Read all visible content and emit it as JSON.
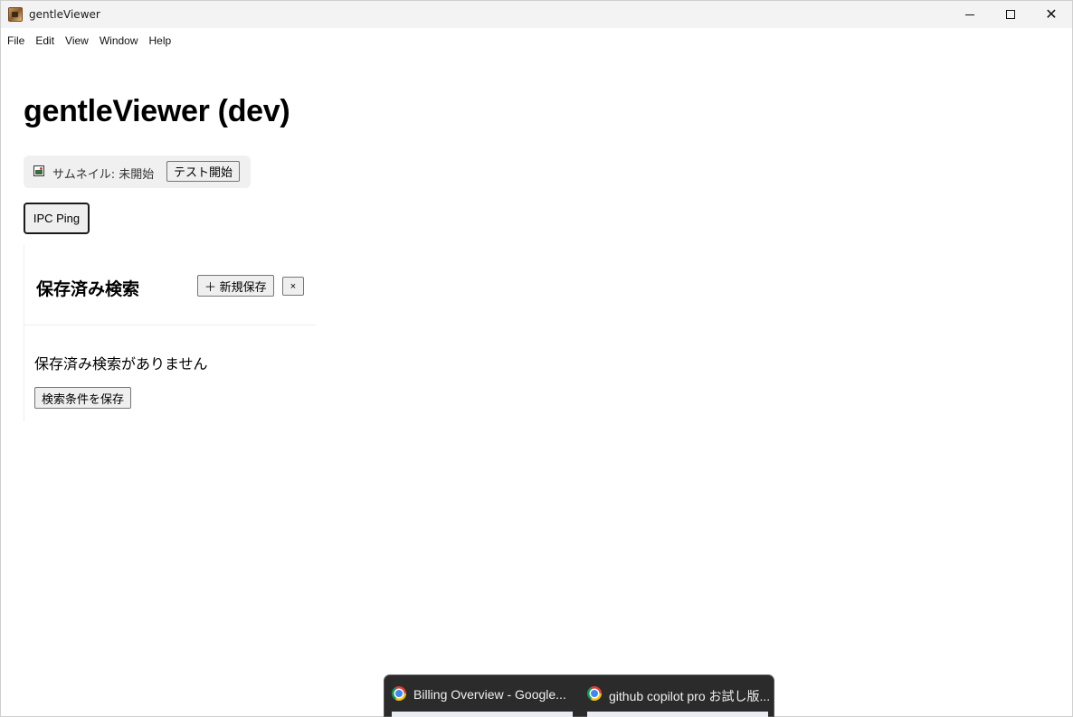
{
  "window": {
    "title": "gentleViewer"
  },
  "menu": [
    "File",
    "Edit",
    "View",
    "Window",
    "Help"
  ],
  "main": {
    "title": "gentleViewer (dev)",
    "thumbnail": {
      "icon": "image-icon",
      "status": "サムネイル: 未開始",
      "test_button": "テスト開始"
    },
    "ipc_button": "IPC Ping",
    "saved_search": {
      "title": "保存済み検索",
      "new_save_button": "＋ 新規保存",
      "close_button": "×",
      "empty_message": "保存済み検索がありません",
      "save_criteria_button": "検索条件を保存"
    }
  },
  "taskbar_popup": {
    "items": [
      {
        "icon": "chrome-icon",
        "label": "Billing Overview - Google..."
      },
      {
        "icon": "chrome-icon",
        "label": "github copilot pro お試し版..."
      }
    ]
  }
}
